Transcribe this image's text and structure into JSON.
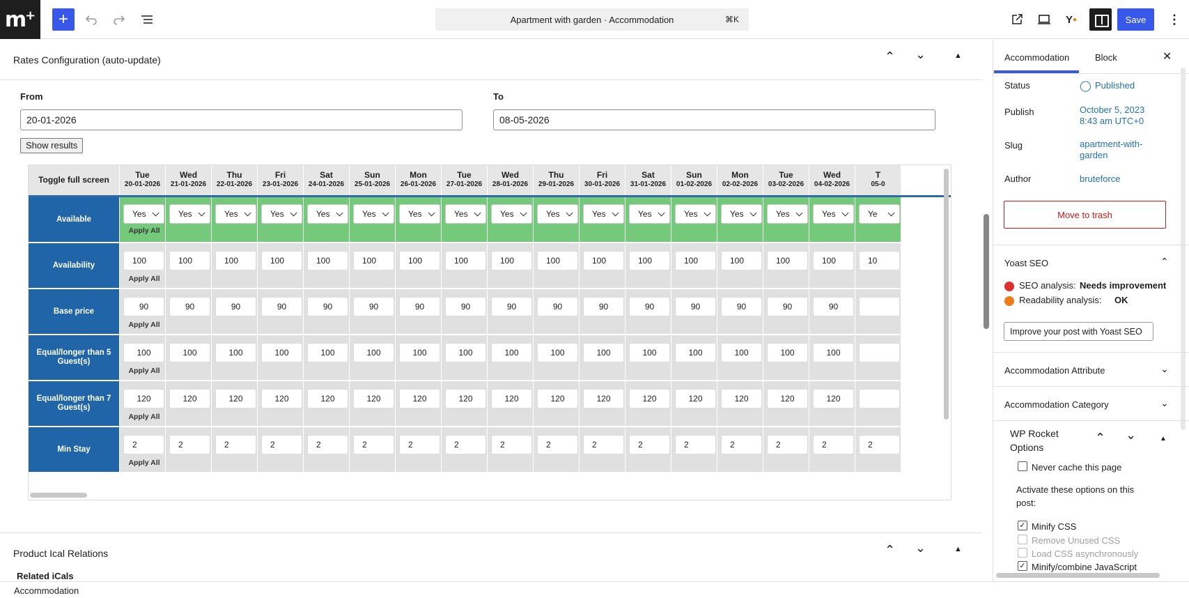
{
  "topbar": {
    "title": "Apartment with garden · Accommodation",
    "shortcut": "⌘K",
    "save_label": "Save"
  },
  "rates": {
    "section_title": "Rates Configuration (auto-update)",
    "from_label": "From",
    "from_value": "20-01-2026",
    "to_label": "To",
    "to_value": "08-05-2026",
    "show_results": "Show results",
    "toggle_full_screen": "Toggle full screen",
    "apply_all": "Apply All",
    "columns": [
      {
        "day": "Tue",
        "date": "20-01-2026"
      },
      {
        "day": "Wed",
        "date": "21-01-2026"
      },
      {
        "day": "Thu",
        "date": "22-01-2026"
      },
      {
        "day": "Fri",
        "date": "23-01-2026"
      },
      {
        "day": "Sat",
        "date": "24-01-2026"
      },
      {
        "day": "Sun",
        "date": "25-01-2026"
      },
      {
        "day": "Mon",
        "date": "26-01-2026"
      },
      {
        "day": "Tue",
        "date": "27-01-2026"
      },
      {
        "day": "Wed",
        "date": "28-01-2026"
      },
      {
        "day": "Thu",
        "date": "29-01-2026"
      },
      {
        "day": "Fri",
        "date": "30-01-2026"
      },
      {
        "day": "Sat",
        "date": "31-01-2026"
      },
      {
        "day": "Sun",
        "date": "01-02-2026"
      },
      {
        "day": "Mon",
        "date": "02-02-2026"
      },
      {
        "day": "Tue",
        "date": "03-02-2026"
      },
      {
        "day": "Wed",
        "date": "04-02-2026"
      },
      {
        "day": "T",
        "date": "05-0"
      }
    ],
    "rows": [
      {
        "label": "Available",
        "value": "Yes",
        "kind": "select"
      },
      {
        "label": "Availability",
        "value": "100",
        "kind": "left"
      },
      {
        "label": "Base price",
        "value": "90",
        "kind": "center"
      },
      {
        "label": "Equal/longer than 5 Guest(s)",
        "value": "100",
        "kind": "center"
      },
      {
        "label": "Equal/longer than 7 Guest(s)",
        "value": "120",
        "kind": "center"
      },
      {
        "label": "Min Stay",
        "value": "2",
        "kind": "left"
      }
    ],
    "partial_values": [
      "Ye",
      "10",
      "",
      "",
      "",
      "2"
    ]
  },
  "ical": {
    "section_title": "Product Ical Relations",
    "related_label": "Related iCals"
  },
  "sidebar": {
    "tab_accommodation": "Accommodation",
    "tab_block": "Block",
    "status_label": "Status",
    "status_value": "Published",
    "publish_label": "Publish",
    "publish_value_1": "October 5, 2023",
    "publish_value_2": "8:43 am UTC+0",
    "slug_label": "Slug",
    "slug_value_1": "apartment-with-",
    "slug_value_2": "garden",
    "author_label": "Author",
    "author_value": "bruteforce",
    "trash_label": "Move to trash",
    "yoast_title": "Yoast SEO",
    "seo_label": "SEO analysis:",
    "seo_value": "Needs improvement",
    "read_label": "Readability analysis:",
    "read_value": "OK",
    "yoast_button": "Improve your post with Yoast SEO",
    "attr_title": "Accommodation Attribute",
    "cat_title": "Accommodation Category",
    "rocket_title_1": "WP Rocket",
    "rocket_title_2": "Options",
    "never_cache": "Never cache this page",
    "activate_1": "Activate these options on this",
    "activate_2": "post:",
    "opt_minify_css": "Minify CSS",
    "opt_remove_css": "Remove Unused CSS",
    "opt_load_css": "Load CSS asynchronously",
    "opt_minify_js": "Minify/combine JavaScript"
  },
  "footer": {
    "breadcrumb": "Accommodation"
  },
  "colors": {
    "accent": "#3858e9",
    "row_label_bg": "#2065a8",
    "available_bg": "#75c97b",
    "cell_bg": "#e0e0e0",
    "trash": "#cc1818",
    "seo_red": "#dc3232",
    "readability_orange": "#ee7c1b"
  }
}
